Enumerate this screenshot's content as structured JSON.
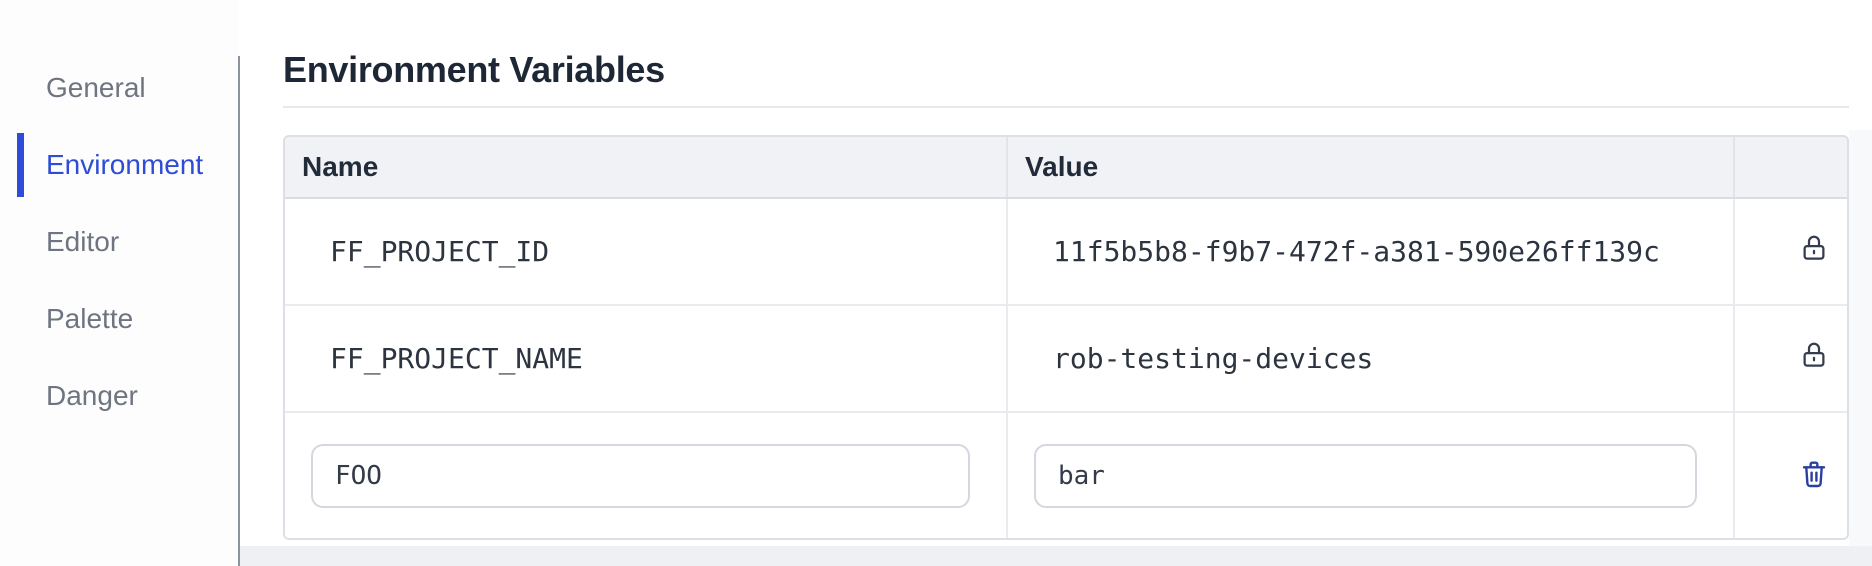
{
  "sidebar": {
    "items": [
      {
        "label": "General",
        "active": false
      },
      {
        "label": "Environment",
        "active": true
      },
      {
        "label": "Editor",
        "active": false
      },
      {
        "label": "Palette",
        "active": false
      },
      {
        "label": "Danger",
        "active": false
      }
    ]
  },
  "main": {
    "title": "Environment Variables",
    "table": {
      "headers": {
        "name": "Name",
        "value": "Value",
        "actions": ""
      },
      "rows": [
        {
          "name": "FF_PROJECT_ID",
          "value": "11f5b5b8-f9b7-472f-a381-590e26ff139c",
          "locked": true
        },
        {
          "name": "FF_PROJECT_NAME",
          "value": "rob-testing-devices",
          "locked": true
        }
      ],
      "new_row": {
        "name_value": "FOO",
        "value_value": "bar",
        "name_placeholder": "",
        "value_placeholder": ""
      }
    }
  },
  "icons": {
    "row_locked": "lock-icon",
    "row_delete": "trash-icon"
  },
  "colors": {
    "accent_blue": "#2e4cd6",
    "trash_blue": "#2a3f9f",
    "icon_slate": "#333d4d",
    "header_bg": "#f1f2f5",
    "table_border": "#dcdfe5"
  }
}
